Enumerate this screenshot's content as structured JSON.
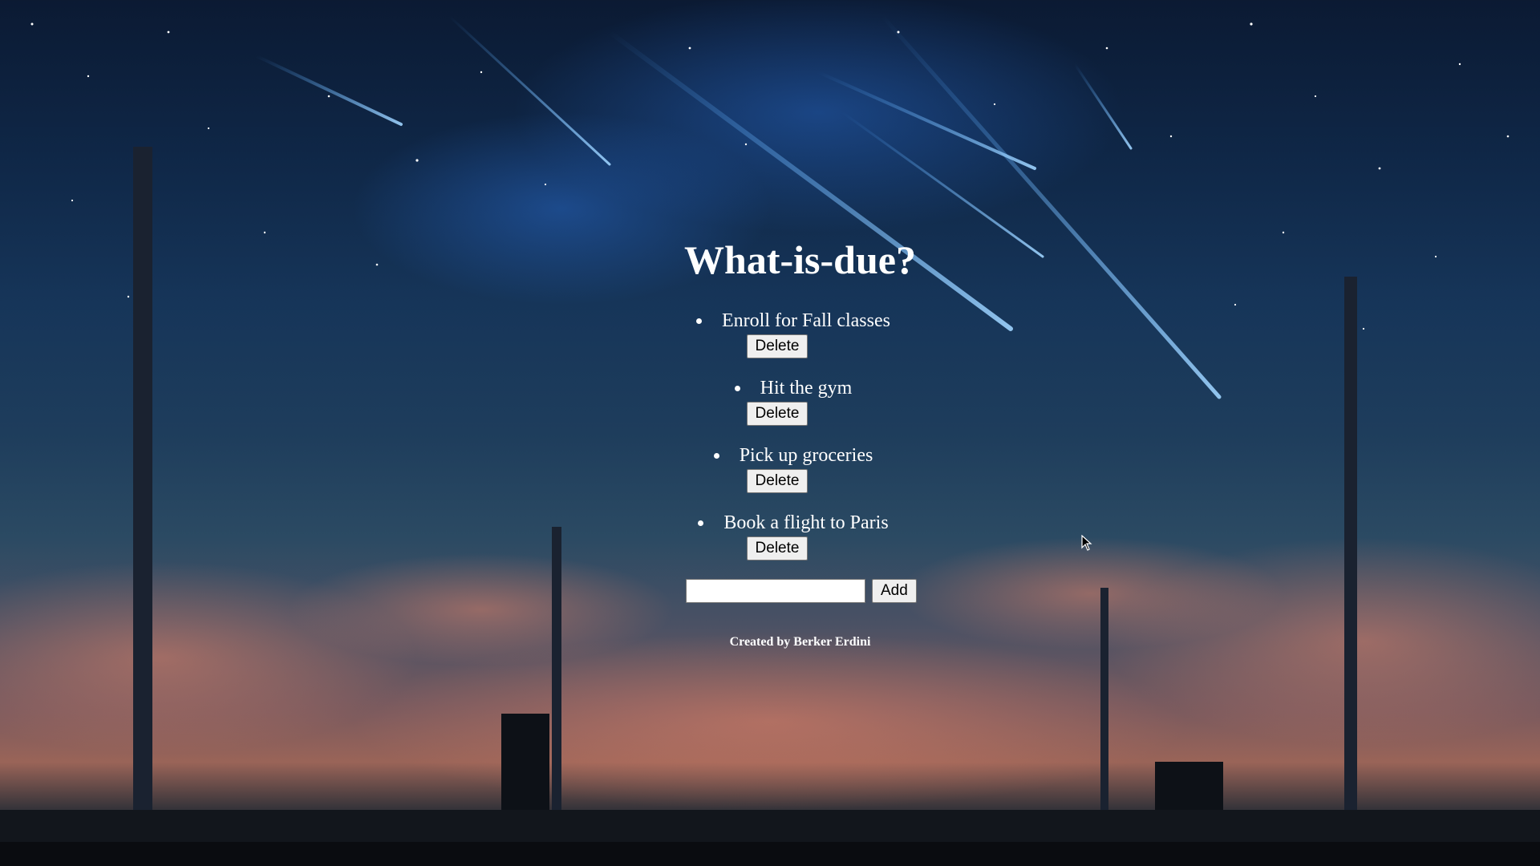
{
  "app": {
    "title": "What-is-due?"
  },
  "todos": [
    {
      "text": "Enroll for Fall classes",
      "delete_label": "Delete"
    },
    {
      "text": "Hit the gym",
      "delete_label": "Delete"
    },
    {
      "text": "Pick up groceries",
      "delete_label": "Delete"
    },
    {
      "text": "Book a flight to Paris",
      "delete_label": "Delete"
    }
  ],
  "add_form": {
    "input_value": "",
    "add_label": "Add"
  },
  "footer": {
    "credit": "Created by Berker Erdini"
  },
  "icons": {
    "cursor": "mouse-pointer-icon"
  },
  "colors": {
    "text": "#ffffff",
    "sky_top": "#0b1a33",
    "sky_horizon": "#9a6458"
  }
}
